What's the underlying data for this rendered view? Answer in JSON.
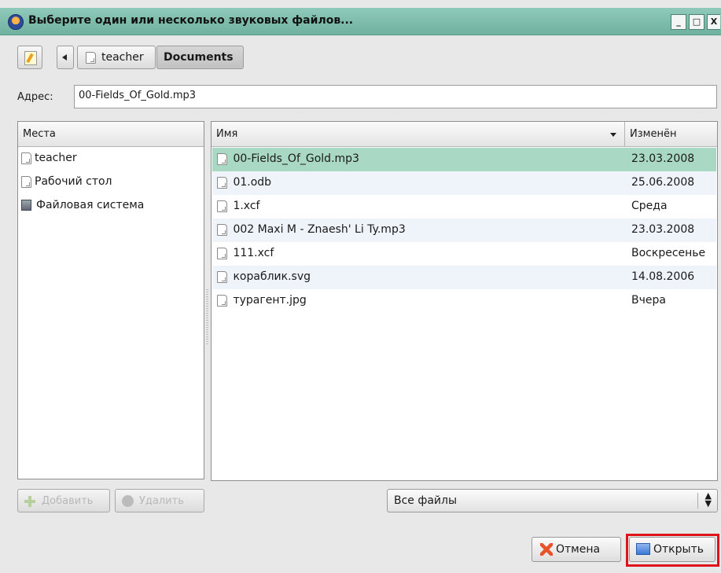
{
  "window": {
    "title": "Выберите один или несколько звуковых файлов...",
    "minimize": "_",
    "maximize": "□",
    "close": "X"
  },
  "path_bar": {
    "crumbs": [
      "teacher",
      "Documents"
    ]
  },
  "address": {
    "label": "Адрес:",
    "value": "00-Fields_Of_Gold.mp3"
  },
  "places": {
    "header": "Места",
    "items": [
      {
        "label": "teacher",
        "icon": "file-icon"
      },
      {
        "label": "Рабочий стол",
        "icon": "file-icon"
      },
      {
        "label": "Файловая система",
        "icon": "disk-icon"
      }
    ]
  },
  "files": {
    "col_name": "Имя",
    "col_modified": "Изменён",
    "rows": [
      {
        "name": "00-Fields_Of_Gold.mp3",
        "date": "23.03.2008"
      },
      {
        "name": "01.odb",
        "date": "25.06.2008"
      },
      {
        "name": "1.xcf",
        "date": "Среда"
      },
      {
        "name": "002 Maxi M - Znaesh' Li Ty.mp3",
        "date": "23.03.2008"
      },
      {
        "name": "111.xcf",
        "date": "Воскресенье"
      },
      {
        "name": "кораблик.svg",
        "date": "14.08.2006"
      },
      {
        "name": "турагент.jpg",
        "date": "Вчера"
      }
    ]
  },
  "buttons": {
    "add": "Добавить",
    "remove": "Удалить",
    "cancel": "Отмена",
    "open": "Открыть"
  },
  "filter": {
    "selected": "Все файлы"
  },
  "colors": {
    "titlebar": "#7dbfae",
    "selection": "#a9d8c4",
    "highlight_box": "#e0131b"
  }
}
